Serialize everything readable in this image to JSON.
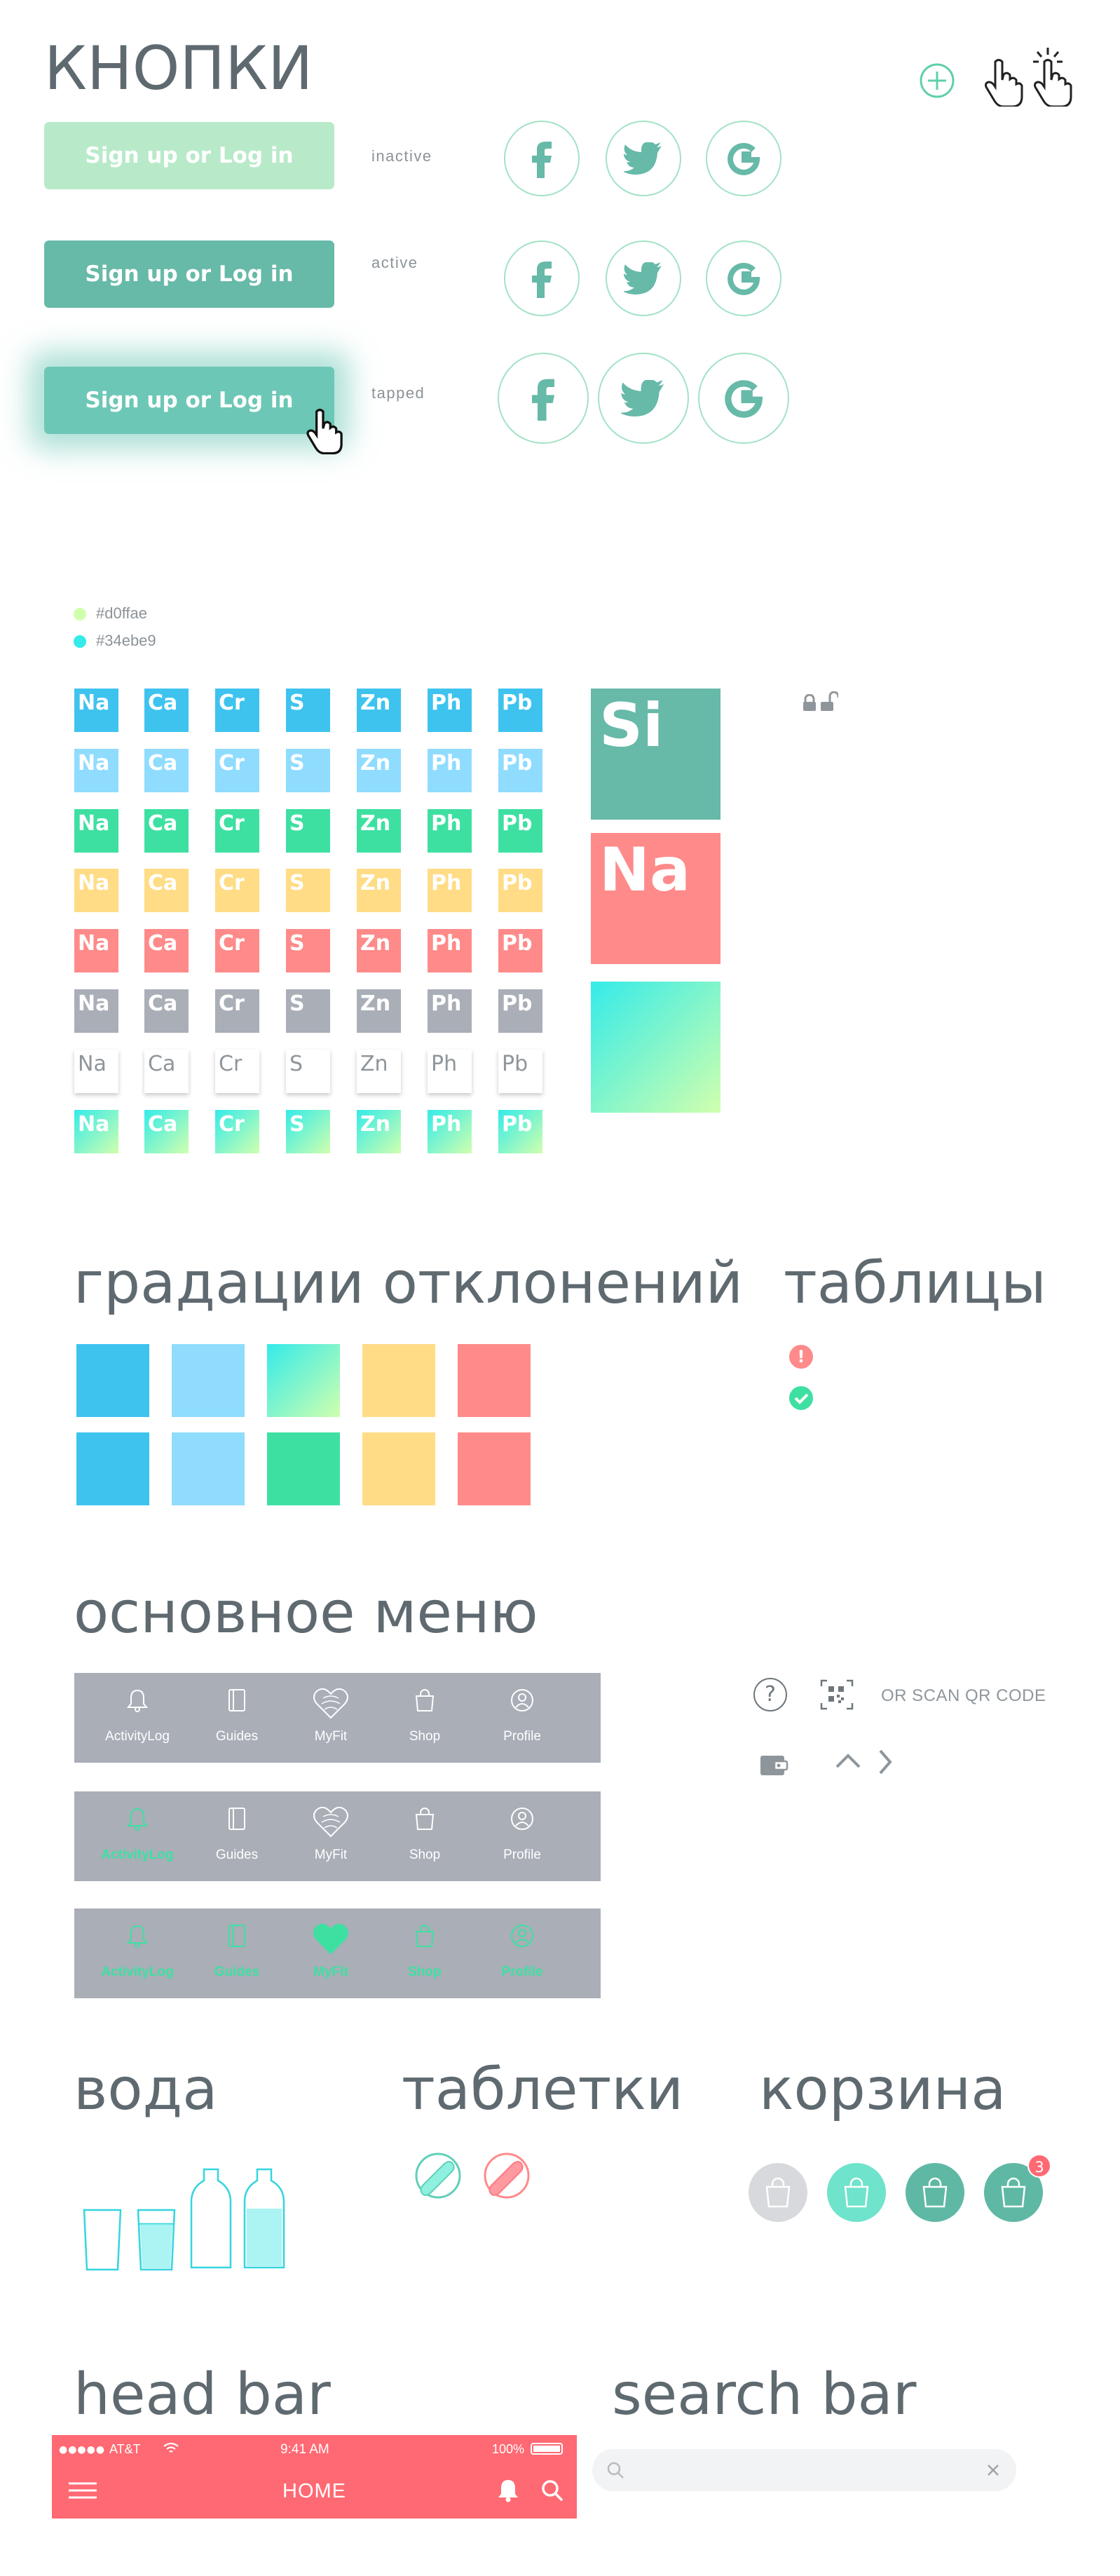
{
  "buttons_section": {
    "title": "КНОПКИ",
    "buttons": [
      {
        "label": "Sign up or Log in",
        "state": "inactive"
      },
      {
        "label": "Sign up or Log in",
        "state": "active"
      },
      {
        "label": "Sign up or Log in",
        "state": "tapped"
      }
    ],
    "social_icons": [
      "facebook-icon",
      "twitter-icon",
      "google-icon"
    ],
    "header_icons": [
      "plus-circle-icon",
      "pointer-hand-icon",
      "tap-hand-icon"
    ]
  },
  "colors": {
    "legend": [
      {
        "hex": "#d0ffae",
        "label": "#d0ffae"
      },
      {
        "hex": "#34ebe9",
        "label": "#34ebe9"
      }
    ],
    "primary_green": "#67b9a8",
    "inactive_green": "#b8eac9",
    "blue": "#3ec3ef",
    "light_blue": "#8fdcff",
    "mint": "#3ee0a2",
    "yellow": "#ffdc85",
    "coral": "#ff8a8a",
    "grey": "#a9aeb7",
    "red_bar": "#ff6973"
  },
  "elements": {
    "symbols": [
      "Na",
      "Ca",
      "Cr",
      "S",
      "Zn",
      "Ph",
      "Pb"
    ],
    "row_styles": [
      "blue",
      "light-blue",
      "mint",
      "yellow",
      "coral",
      "grey",
      "white",
      "gradient"
    ],
    "big_tiles": [
      "Si",
      "Na",
      ""
    ],
    "lock_icons": [
      "lock-closed-icon",
      "lock-open-icon"
    ]
  },
  "gradations": {
    "title": "градации отклонений",
    "row1": [
      "blue",
      "light-blue",
      "gradient",
      "yellow",
      "coral"
    ],
    "row2": [
      "blue",
      "light-blue",
      "mint",
      "yellow",
      "coral"
    ]
  },
  "tables": {
    "title": "таблицы",
    "icons": [
      "error-icon",
      "check-icon"
    ]
  },
  "main_menu": {
    "title": "основное меню",
    "items": [
      "ActivityLog",
      "Guides",
      "MyFit",
      "Shop",
      "Profile"
    ],
    "active_states": [
      "none",
      "first",
      "all"
    ],
    "side": {
      "scan_text": "OR SCAN QR CODE",
      "icons": [
        "help-icon",
        "qr-code-icon",
        "wallet-icon",
        "chevron-up-icon",
        "chevron-right-icon"
      ]
    }
  },
  "water": {
    "title": "вода"
  },
  "pills": {
    "title": "таблетки"
  },
  "cart": {
    "title": "корзина",
    "badge": "3"
  },
  "head_bar": {
    "title": "head bar",
    "carrier": "AT&T",
    "time": "9:41 AM",
    "battery": "100%",
    "label": "HOME"
  },
  "search_bar": {
    "title": "search bar"
  }
}
